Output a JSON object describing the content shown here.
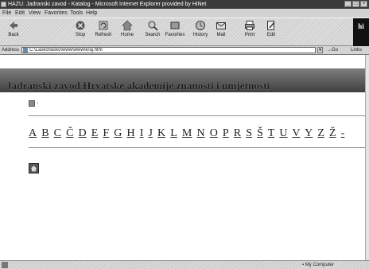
{
  "window": {
    "title": "HAZU: Jadranski zavod - Katalog - Microsoft Internet Explorer provided by HiNet",
    "buttons": [
      "_",
      "□",
      "×"
    ]
  },
  "menu": [
    "File",
    "Edit",
    "View",
    "Favorites",
    "Tools",
    "Help"
  ],
  "toolbar": {
    "buttons": [
      {
        "label": "Back",
        "icon": "back-arrow-icon"
      },
      {
        "label": "Stop",
        "icon": "stop-icon"
      },
      {
        "label": "Refresh",
        "icon": "refresh-icon"
      },
      {
        "label": "Home",
        "icon": "home-icon"
      },
      {
        "label": "Search",
        "icon": "search-icon"
      },
      {
        "label": "Favorites",
        "icon": "favorites-icon"
      },
      {
        "label": "History",
        "icon": "history-icon"
      },
      {
        "label": "Mail",
        "icon": "mail-icon"
      },
      {
        "label": "Print",
        "icon": "print-icon"
      },
      {
        "label": "Edit",
        "icon": "edit-icon"
      }
    ],
    "brand": "hi"
  },
  "address": {
    "label": "Address",
    "url": "C:\\Lasko\\lasko\\www\\www\\kraj.htm",
    "go": "Go",
    "links": "Links"
  },
  "page": {
    "banner_title": "Jadranski zavod Hrvatske akademije znanosti i umjetnosti",
    "mini_dash": "-",
    "alphabet": [
      "A",
      "B",
      "C",
      "Č",
      "D",
      "E",
      "F",
      "G",
      "H",
      "I",
      "J",
      "K",
      "L",
      "M",
      "N",
      "O",
      "P",
      "R",
      "S",
      "Š",
      "T",
      "U",
      "V",
      "Y",
      "Z",
      "Ž",
      "-"
    ]
  },
  "status": {
    "zone": "My Computer"
  }
}
